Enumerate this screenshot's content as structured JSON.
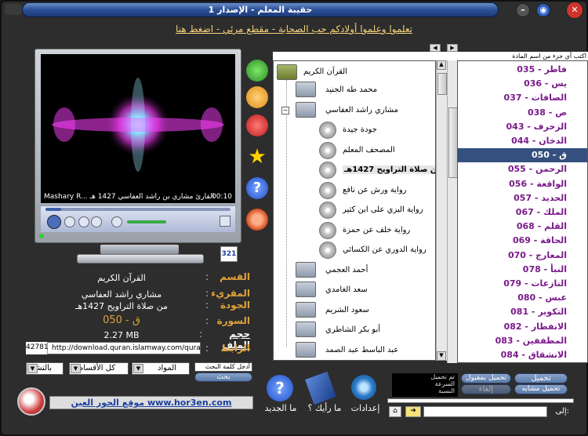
{
  "window": {
    "title": "حقيبة المعلم - الإصدار 1",
    "top_link": "تعلموا وعلموا أولادكم حب الصحابة - مقطع مرئي - اضغط هنا"
  },
  "player": {
    "caption": "Mashary R... القارئ مشاري بن راشد العفاسي 1427 هـ",
    "time": "00:10",
    "corner_badge": "321"
  },
  "info": {
    "section_label": "القسم",
    "section_value": "القرآن الكريم",
    "reciter_label": "المقريء",
    "reciter_value": "مشاري راشد العفاسي",
    "quality_label": "الجودة",
    "quality_value": "من صلاة التراويح 1427هـ",
    "sura_label": "السورة",
    "sura_value": "050 - ق",
    "size_label": "حجم الملف",
    "size_value": "2.27 MB",
    "url_label": "الرابط",
    "url_value": "http://download.quran.islamway.com/quran3/307/",
    "url_number": "42781"
  },
  "search": {
    "placeholder": "أدخل كلمة البحث",
    "button": "بحث",
    "select1": "المواد",
    "select2": "كل الأقسام",
    "select3": "بالتشابه"
  },
  "site_link": "موقع الحور العين www.hor3en.com",
  "tree": {
    "root": "القرآن الكريم",
    "items": [
      {
        "label": "محمد طه الجنيد",
        "type": "folder",
        "level": 1
      },
      {
        "label": "مشاري راشد العفاسي",
        "type": "folder",
        "level": 1,
        "expanded": true
      },
      {
        "label": "جودة جيدة",
        "type": "disc",
        "level": 2
      },
      {
        "label": "المصحف المعلم",
        "type": "disc",
        "level": 2
      },
      {
        "label": "من صلاة التراويح 1427هـ",
        "type": "disc",
        "level": 2,
        "selected": true
      },
      {
        "label": "رواية ورش عن نافع",
        "type": "disc",
        "level": 2
      },
      {
        "label": "رواية البزي على ابن كثير",
        "type": "disc",
        "level": 2
      },
      {
        "label": "رواية خلف عن حمزة",
        "type": "disc",
        "level": 2
      },
      {
        "label": "رواية الدوري عن الكسائي",
        "type": "disc",
        "level": 2
      },
      {
        "label": "أحمد العجمي",
        "type": "folder",
        "level": 1
      },
      {
        "label": "سعد الغامدي",
        "type": "folder",
        "level": 1
      },
      {
        "label": "سعود الشريم",
        "type": "folder",
        "level": 1
      },
      {
        "label": "أبو بكر الشاطري",
        "type": "folder",
        "level": 1
      },
      {
        "label": "عبد الباسط عبد الصمد",
        "type": "folder",
        "level": 1
      }
    ]
  },
  "suras": {
    "header": "اكتب أي جزء من اسم المادة",
    "items": [
      "035 - فاطر",
      "036 - يس",
      "037 - الصافات",
      "038 - ص",
      "043 - الزخرف",
      "044 - الدخان",
      "050 - ق",
      "055 - الرحمن",
      "056 - الواقعة",
      "057 - الحديد",
      "067 - الملك",
      "068 - القلم",
      "069 - الحاقة",
      "070 - المعارج",
      "078 - النبأ",
      "079 - النازعات",
      "080 - عبس",
      "081 - التكوير",
      "082 - الانفطار",
      "083 - المطففين",
      "084 - الانشقاق"
    ],
    "selected_index": 6
  },
  "bottom": {
    "whats_new": "ما الجديد",
    "opinion": "ما رأيك ؟",
    "settings": "إعدادات",
    "status_line1": "تم تحميل",
    "status_line2": "السرعة",
    "status_line3": "النسبة",
    "btn_download": "تحميل",
    "btn_download_from": "تحميل بمقبول",
    "btn_download_similar": "تحميل مشابه",
    "btn_stop": "إلغاء",
    "path_label": "إلى:"
  },
  "colors": {
    "accent": "#e0a23a",
    "sura_text": "#7a1a8a",
    "selection": "#34507e",
    "title_bar": "#2b4f96"
  }
}
